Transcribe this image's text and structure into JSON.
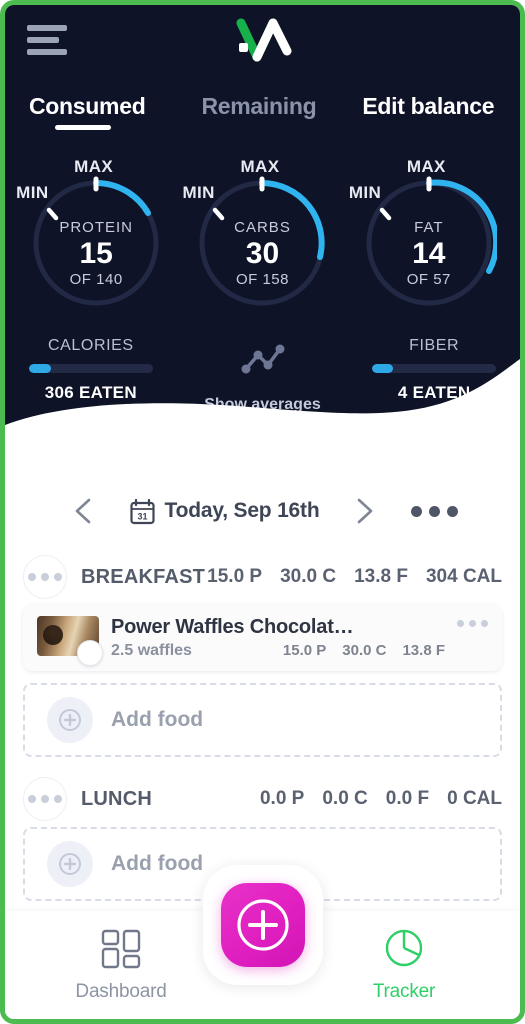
{
  "app": {
    "logo_name": "app-logo",
    "menu_icon": "hamburger-menu-icon",
    "brand_green": "#4CBB50",
    "accent_cyan": "#2fa8e8",
    "dark_bg": "#0f1328",
    "fab_magenta": "#e01fc0",
    "tracker_green": "#2fcf68"
  },
  "tabs": [
    {
      "label": "Consumed",
      "active": true
    },
    {
      "label": "Remaining",
      "active": false
    },
    {
      "label": "Edit balance",
      "active": false
    }
  ],
  "rings": [
    {
      "name": "PROTEIN",
      "value": "15",
      "of": "OF 140",
      "min_label": "MIN",
      "max_label": "MAX",
      "consumed": 15,
      "target": 140,
      "arc_percent": 17
    },
    {
      "name": "CARBS",
      "value": "30",
      "of": "OF 158",
      "min_label": "MIN",
      "max_label": "MAX",
      "consumed": 30,
      "target": 158,
      "arc_percent": 21
    },
    {
      "name": "FAT",
      "value": "14",
      "of": "OF 57",
      "min_label": "MIN",
      "max_label": "MAX",
      "consumed": 14,
      "target": 57,
      "arc_percent": 25
    }
  ],
  "stats": {
    "calories": {
      "title": "CALORIES",
      "eaten": "306 EATEN",
      "bar_percent": 18
    },
    "fiber": {
      "title": "FIBER",
      "eaten": "4 EATEN",
      "bar_percent": 17
    },
    "averages": {
      "label": "Show averages",
      "icon": "line-chart-icon"
    }
  },
  "date_nav": {
    "prev_icon": "chevron-left-icon",
    "next_icon": "chevron-right-icon",
    "calendar_icon": "calendar-icon",
    "calendar_day": "31",
    "label": "Today, Sep 16th",
    "more_icon": "more-options-icon"
  },
  "meals": [
    {
      "name": "BREAKFAST",
      "macros": [
        "15.0 P",
        "30.0 C",
        "13.8 F",
        "304 CAL"
      ],
      "foods": [
        {
          "title": "Power Waffles Chocolat…",
          "serving": "2.5 waffles",
          "macros": [
            "15.0 P",
            "30.0 C",
            "13.8 F"
          ],
          "thumb_name": "food-thumbnail"
        }
      ],
      "add_label": "Add food"
    },
    {
      "name": "LUNCH",
      "macros": [
        "0.0 P",
        "0.0 C",
        "0.0 F",
        "0 CAL"
      ],
      "foods": [],
      "add_label": "Add food"
    }
  ],
  "bottom_nav": {
    "dashboard": {
      "label": "Dashboard",
      "icon": "dashboard-grid-icon",
      "active": false
    },
    "add": {
      "icon": "plus-circle-icon",
      "label": ""
    },
    "tracker": {
      "label": "Tracker",
      "icon": "pie-chart-icon",
      "active": true
    }
  }
}
